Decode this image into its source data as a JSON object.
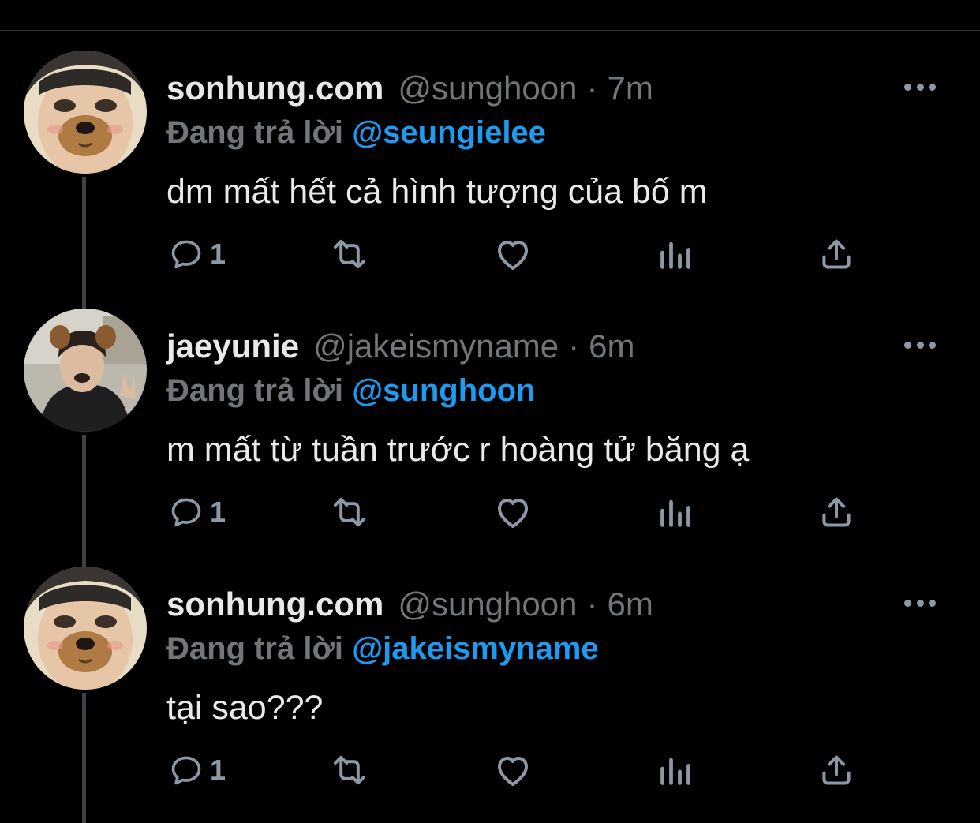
{
  "colors": {
    "background": "#000000",
    "text_primary": "#e7e9ea",
    "text_secondary": "#71767b",
    "mention": "#1d9bf0",
    "icon": "#8b98a5",
    "thread_line": "#3e4144"
  },
  "action_icons": [
    "reply-icon",
    "retweet-icon",
    "like-icon",
    "analytics-icon",
    "share-icon"
  ],
  "tweets": [
    {
      "display_name": "sonhung.com",
      "handle": "@sunghoon",
      "separator": "·",
      "time": "7m",
      "reply_label": "Đang trả lời",
      "reply_to": "@seungielee",
      "text": "dm mất hết cả hình tượng của bố m",
      "reply_count": "1",
      "avatar": "dog-filter-selfie-avatar"
    },
    {
      "display_name": "jaeyunie",
      "handle": "@jakeismyname",
      "separator": "·",
      "time": "6m",
      "reply_label": "Đang trả lời",
      "reply_to": "@sunghoon",
      "text": "m mất từ tuần trước r hoàng tử băng ạ",
      "reply_count": "1",
      "avatar": "dog-ears-selfie-avatar"
    },
    {
      "display_name": "sonhung.com",
      "handle": "@sunghoon",
      "separator": "·",
      "time": "6m",
      "reply_label": "Đang trả lời",
      "reply_to": "@jakeismyname",
      "text": "tại sao???",
      "reply_count": "1",
      "avatar": "dog-filter-selfie-avatar"
    }
  ]
}
